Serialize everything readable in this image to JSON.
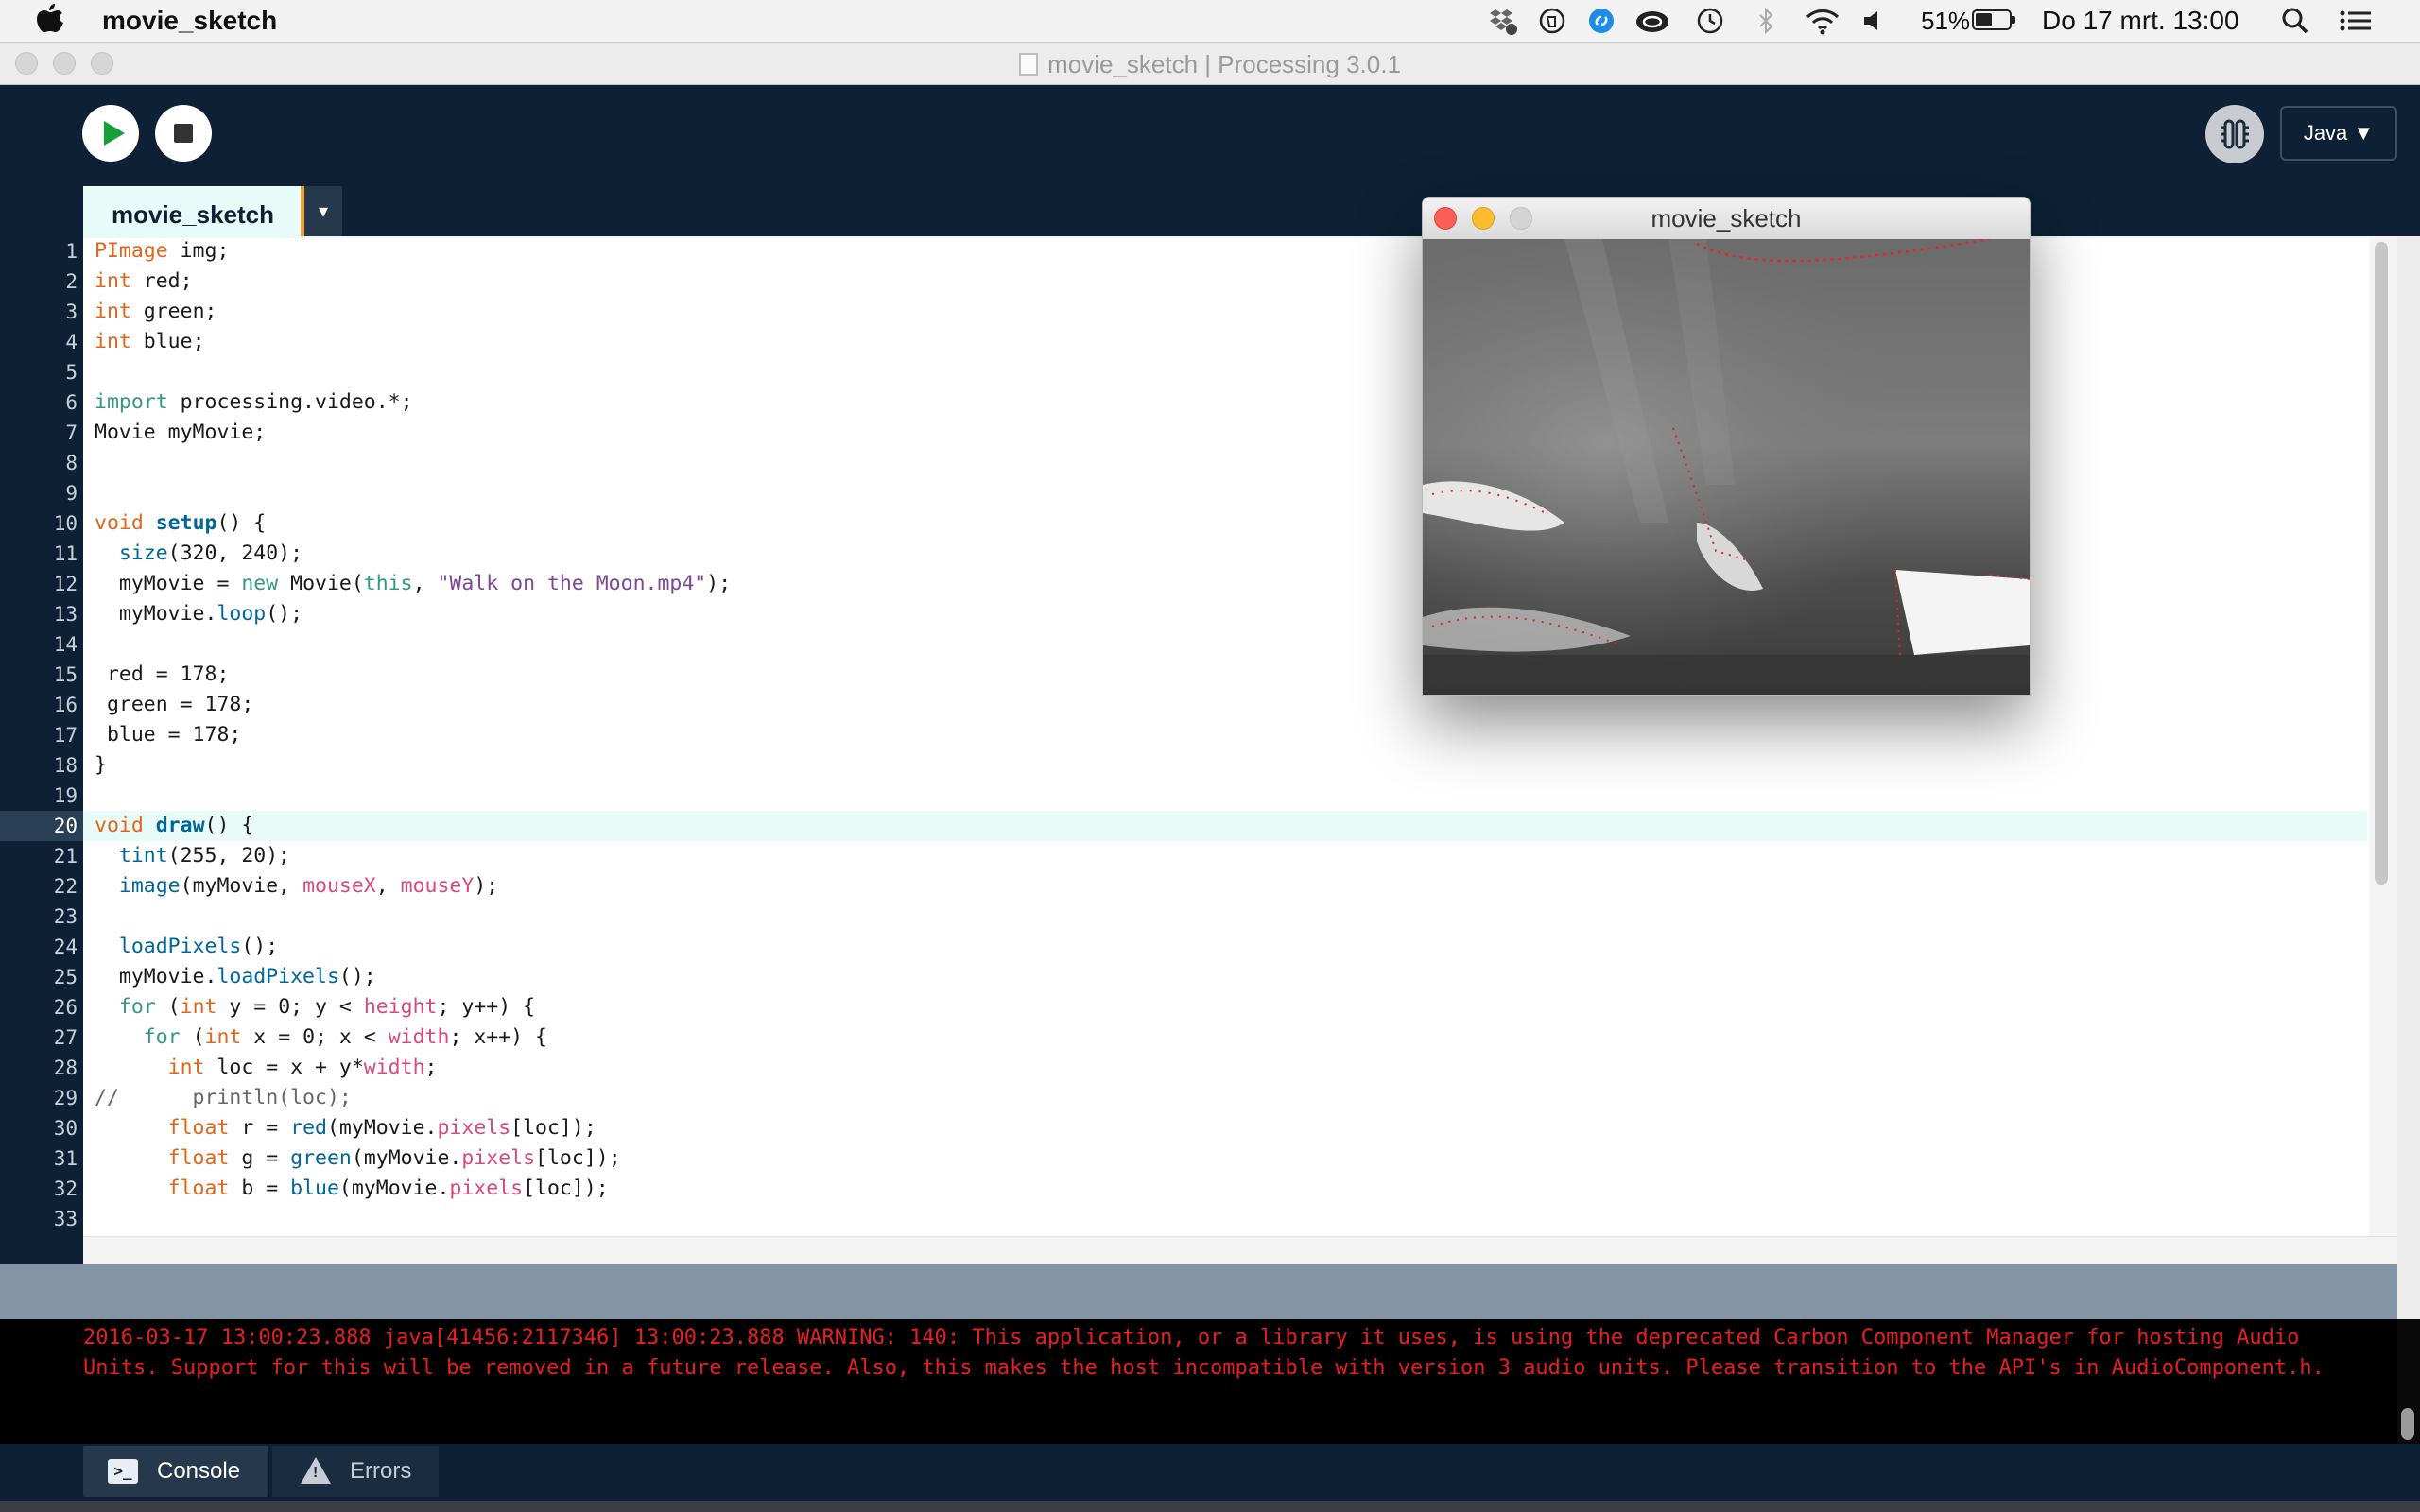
{
  "menubar": {
    "app_name": "movie_sketch",
    "battery": "51%",
    "battery_level": 0.51,
    "clock": "Do 17 mrt.  13:00",
    "icons": [
      "dropbox-icon",
      "evernote-icon",
      "shazam-icon",
      "creative-cloud-icon",
      "time-machine-icon",
      "bluetooth-icon",
      "wifi-icon",
      "volume-icon",
      "spotlight-icon",
      "notification-center-icon"
    ]
  },
  "window": {
    "title": "movie_sketch | Processing 3.0.1"
  },
  "toolbar": {
    "mode": "Java ▼"
  },
  "tabs": {
    "main": "movie_sketch",
    "menu": "▾"
  },
  "editor": {
    "current_line": 20,
    "line_numbers": [
      "1",
      "2",
      "3",
      "4",
      "5",
      "6",
      "7",
      "8",
      "9",
      "10",
      "11",
      "12",
      "13",
      "14",
      "15",
      "16",
      "17",
      "18",
      "19",
      "20",
      "21",
      "22",
      "23",
      "24",
      "25",
      "26",
      "27",
      "28",
      "29",
      "30",
      "31",
      "32",
      "33"
    ],
    "lines": [
      "PImage img;",
      "int red;",
      "int green;",
      "int blue;",
      "",
      "import processing.video.*;",
      "Movie myMovie;",
      "",
      "",
      "void setup() {",
      "  size(320, 240);",
      "  myMovie = new Movie(this, \"Walk on the Moon.mp4\");",
      "  myMovie.loop();",
      "",
      " red = 178;",
      " green = 178;",
      " blue = 178;",
      "}",
      "",
      "void draw() {",
      "  tint(255, 20);",
      "  image(myMovie, mouseX, mouseY);",
      "",
      "  loadPixels();",
      "  myMovie.loadPixels();",
      "  for (int y = 0; y < height; y++) {",
      "    for (int x = 0; x < width; x++) {",
      "      int loc = x + y*width;",
      "//      println(loc);",
      "      float r = red(myMovie.pixels[loc]);",
      "      float g = green(myMovie.pixels[loc]);",
      "      float b = blue(myMovie.pixels[loc]);",
      ""
    ]
  },
  "console": {
    "message": "2016-03-17 13:00:23.888 java[41456:2117346] 13:00:23.888 WARNING:  140: This application, or a library it uses, is using the deprecated Carbon Component Manager for hosting Audio Units. Support for this will be removed in a future release. Also, this makes the host incompatible with version 3 audio units. Please transition to the API's in AudioComponent.h."
  },
  "bottom_tabs": {
    "console": "Console",
    "errors": "Errors"
  },
  "sketch_window": {
    "title": "movie_sketch"
  },
  "colors": {
    "background": "#0d2035",
    "console_text": "#e62020",
    "keyword": "#33997e",
    "type": "#e2661a",
    "function": "#006699",
    "string": "#7d4793",
    "variable": "#d94a7a"
  }
}
